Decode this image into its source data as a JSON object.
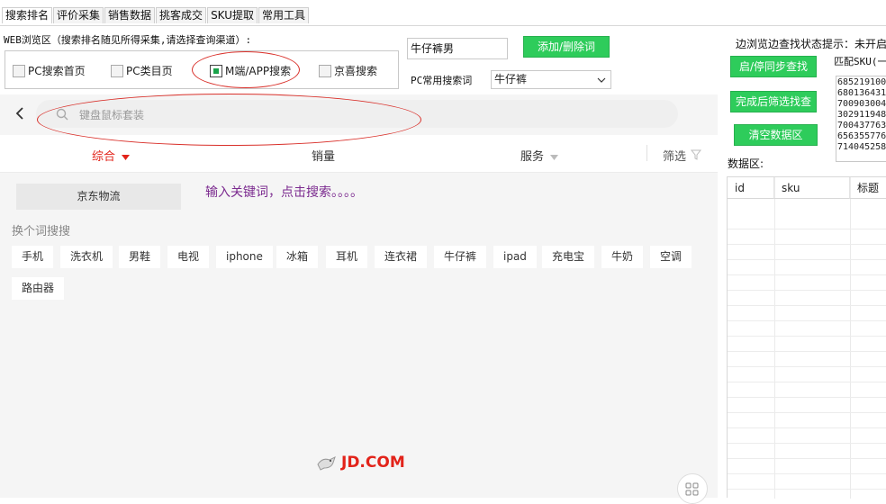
{
  "tabs": [
    "搜索排名",
    "评价采集",
    "销售数据",
    "挑客成交",
    "SKU提取",
    "常用工具"
  ],
  "web_section_label": "WEB浏览区（搜索排名随见所得采集,请选择查询渠道）:",
  "channels": [
    {
      "label": "PC搜索首页",
      "checked": false
    },
    {
      "label": "PC类目页",
      "checked": false
    },
    {
      "label": "M端/APP搜索",
      "checked": true
    },
    {
      "label": "京喜搜索",
      "checked": false
    }
  ],
  "keyword_input": {
    "value": "牛仔裤男"
  },
  "add_delete_button": "添加/删除词",
  "common_search": {
    "label": "PC常用搜索词",
    "selected": "牛仔裤"
  },
  "right_panel": {
    "status_label": "边浏览边查找状态提示：未开启",
    "sync_button": "启/停同步查找",
    "filter_button": "完成后筛选找查",
    "clear_button": "清空数据区",
    "match_label": "匹配SKU(一",
    "sku_list": [
      "685219100",
      "680136431",
      "700903004",
      "302911948",
      "700437763",
      "656355776",
      "714045258"
    ],
    "data_area_label": "数据区:",
    "columns": [
      "id",
      "sku",
      "标题"
    ]
  },
  "jd_page": {
    "search_placeholder": "键盘鼠标套装",
    "sorts": [
      "综合",
      "销量",
      "服务",
      "筛选"
    ],
    "logistics_button": "京东物流",
    "hint_text": "输入关键词，点击搜索。。。。",
    "switch_label": "换个词搜搜",
    "hot_words": [
      "手机",
      "洗衣机",
      "男鞋",
      "电视",
      "iphone",
      "冰箱",
      "耳机",
      "连衣裙",
      "牛仔裤",
      "ipad",
      "充电宝",
      "牛奶",
      "空调",
      "路由器"
    ],
    "logo_text": "JD.COM"
  },
  "colors": {
    "accent_red": "#e2231a",
    "green_button": "#2ecc5b",
    "hint_purple": "#7b2a8f",
    "annotation_red": "#d9302a"
  }
}
